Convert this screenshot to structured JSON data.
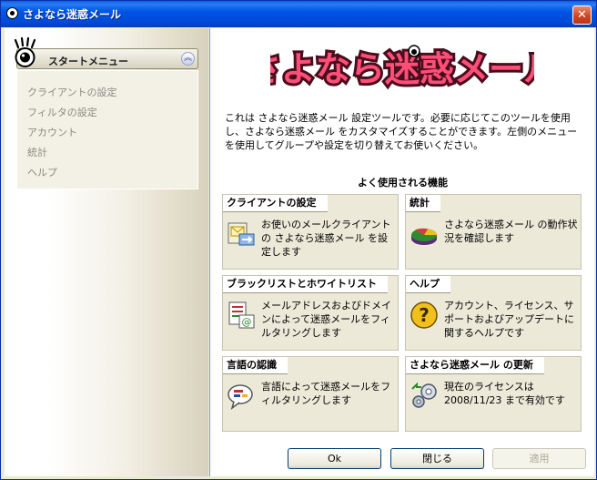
{
  "window": {
    "title": "さよなら迷惑メール"
  },
  "sidebar": {
    "menu_title": "スタートメニュー",
    "items": [
      {
        "label": "クライアントの設定"
      },
      {
        "label": "フィルタの設定"
      },
      {
        "label": "アカウント"
      },
      {
        "label": "統計"
      },
      {
        "label": "ヘルプ"
      }
    ]
  },
  "main": {
    "logo_text": "さよなら迷惑メール",
    "intro": "これは さよなら迷惑メール 設定ツールです。必要に応じてこのツールを使用し、さよなら迷惑メール をカスタマイズすることができます。左側のメニューを使用してグループや設定を切り替えてお使いください。",
    "faq_title": "よく使用される機能",
    "cards": [
      {
        "title": "クライアントの設定",
        "desc": "お使いのメールクライアントの さよなら迷惑メール を設定します",
        "icon": "mail-client-icon"
      },
      {
        "title": "統計",
        "desc": "さよなら迷惑メール の動作状況を確認します",
        "icon": "pie-chart-icon"
      },
      {
        "title": "ブラックリストとホワイトリスト",
        "desc": "メールアドレスおよびドメインによって迷惑メールをフィルタリングします",
        "icon": "address-list-icon"
      },
      {
        "title": "ヘルプ",
        "desc": "アカウント、ライセンス、サポートおよびアップデートに関するヘルプです",
        "icon": "help-icon"
      },
      {
        "title": "言語の認識",
        "desc": "言語によって迷惑メールをフィルタリングします",
        "icon": "language-icon"
      },
      {
        "title": "さよなら迷惑メール の更新",
        "desc": "現在のライセンスは 2008/11/23 まで有効です",
        "icon": "update-icon"
      }
    ]
  },
  "buttons": {
    "ok": "Ok",
    "close": "閉じる",
    "apply": "適用"
  },
  "colors": {
    "logo_pink": "#ff4f79",
    "title_blue": "#0055e5"
  }
}
